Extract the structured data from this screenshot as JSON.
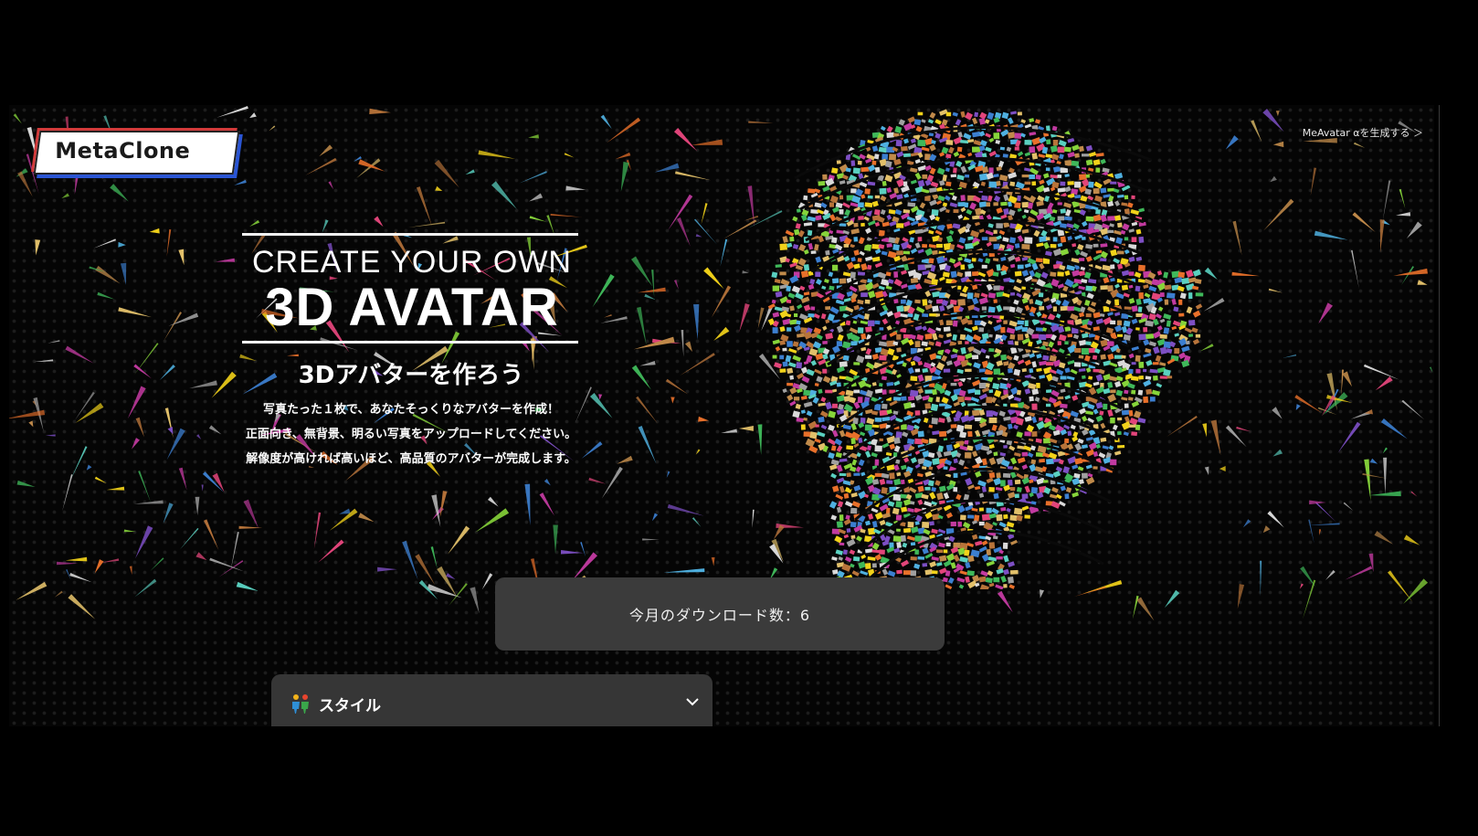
{
  "brand": {
    "logo_text": "MetaClone"
  },
  "header": {
    "link_label": "MeAvatar αを生成する ＞"
  },
  "hero": {
    "title_line1": "CREATE YOUR OWN",
    "title_line2": "3D AVATAR",
    "jp_title": "3Dアバターを作ろう",
    "description": [
      "写真たった１枚で、あなたそっくりなアバターを作成！",
      "正面向き、無背景、明るい写真をアップロードしてください。",
      "解像度が高ければ高いほど、高品質のアバターが完成します。"
    ]
  },
  "download_counter": {
    "text": "今月のダウンロード数：6"
  },
  "style_select": {
    "label": "スタイル",
    "icon": "people-icon",
    "chevron": "chevron-down-icon"
  },
  "colors": {
    "background": "#000000",
    "panel": "#3b3b3b",
    "select_panel": "#363636",
    "text": "#ffffff",
    "logo_accent_blue": "#2a55d4",
    "logo_accent_red": "#d23a3a"
  }
}
